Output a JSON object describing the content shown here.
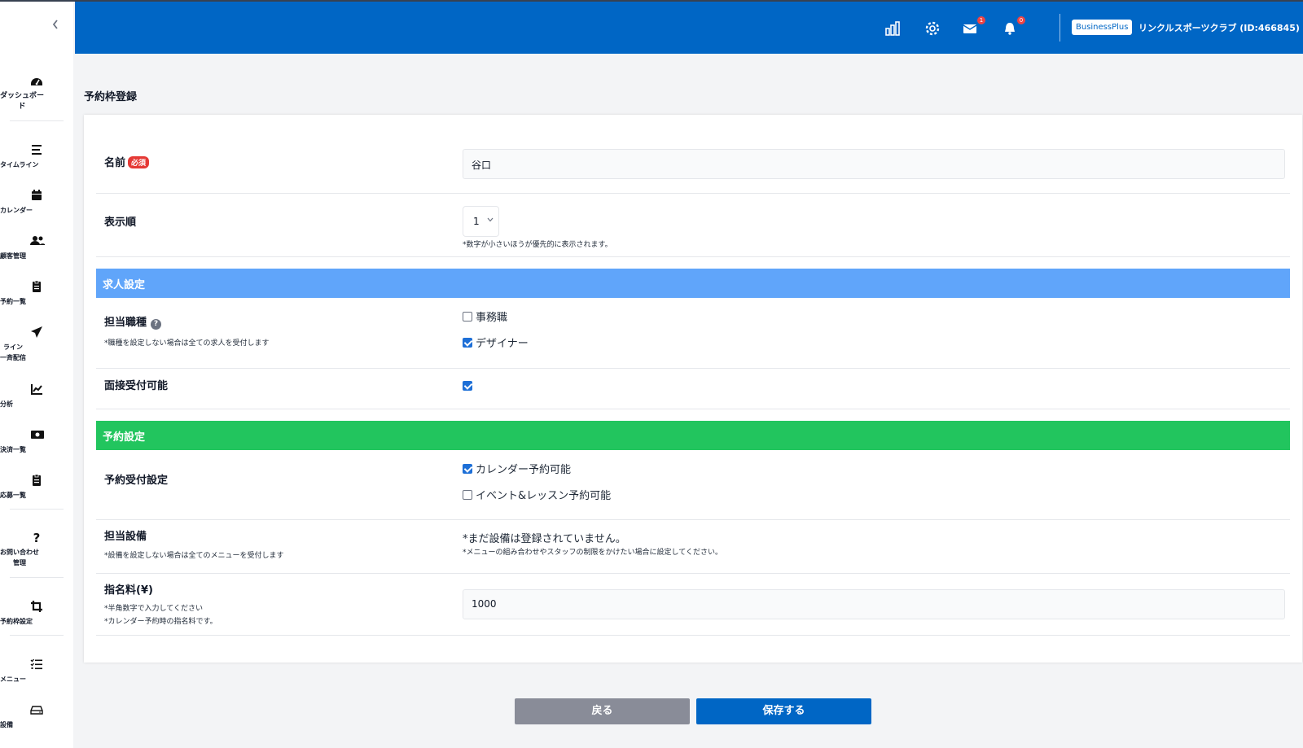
{
  "sidebar": {
    "collapse_icon": "chevron-left-icon",
    "items": [
      {
        "label": "ダッシュボー\nド",
        "icon": "dashboard-icon"
      },
      {
        "label": "タイムライン",
        "icon": "timeline-icon"
      },
      {
        "label": "カレンダー",
        "icon": "calendar-icon"
      },
      {
        "label": "顧客管理",
        "icon": "users-icon"
      },
      {
        "label": "予約一覧",
        "icon": "clipboard-icon"
      },
      {
        "label": "ライン\n一斉配信",
        "icon": "send-icon"
      },
      {
        "label": "分析",
        "icon": "chart-line-icon"
      },
      {
        "label": "決済一覧",
        "icon": "money-icon"
      },
      {
        "label": "応募一覧",
        "icon": "clipboard-list-icon"
      },
      {
        "label": "お問い合わせ\n管理",
        "icon": "question-icon"
      },
      {
        "label": "予約枠設定",
        "icon": "crop-icon"
      },
      {
        "label": "メニュー",
        "icon": "list-icon"
      },
      {
        "label": "設備",
        "icon": "equipment-icon"
      }
    ]
  },
  "header": {
    "mail_count": "1",
    "notification_count": "0",
    "plan_badge": "BusinessPlus",
    "account": "リンクルスポーツクラブ (ID:466845)",
    "bg_color": "#0066c5"
  },
  "page": {
    "title": "予約枠登録"
  },
  "form": {
    "name": {
      "label": "名前",
      "required": "必須",
      "value": "谷口"
    },
    "order": {
      "label": "表示順",
      "value": "1",
      "note": "*数字が小さいほうが優先的に表示されます。"
    },
    "job_section": {
      "title": "求人設定",
      "color": "#60a5fa"
    },
    "job_type": {
      "label": "担当職種",
      "note": "*職種を設定しない場合は全ての求人を受付します",
      "options": [
        {
          "label": "事務職",
          "checked": false
        },
        {
          "label": "デザイナー",
          "checked": true
        }
      ]
    },
    "interview": {
      "label": "面接受付可能",
      "checked": true
    },
    "reserve_section": {
      "title": "予約設定",
      "color": "#22c55e"
    },
    "reserve_accept": {
      "label": "予約受付設定",
      "options": [
        {
          "label": "カレンダー予約可能",
          "checked": true
        },
        {
          "label": "イベント&レッスン予約可能",
          "checked": false
        }
      ]
    },
    "equipment": {
      "label": "担当設備",
      "note": "*設備を設定しない場合は全てのメニューを受付します",
      "message": "*まだ設備は登録されていません。",
      "sub_message": "*メニューの組み合わせやスタッフの制限をかけたい場合に設定してください。"
    },
    "fee": {
      "label": "指名料(¥)",
      "note1": "*半角数字で入力してください",
      "note2": "*カレンダー予約時の指名料です。",
      "value": "1000"
    }
  },
  "buttons": {
    "back": "戻る",
    "save": "保存する"
  }
}
